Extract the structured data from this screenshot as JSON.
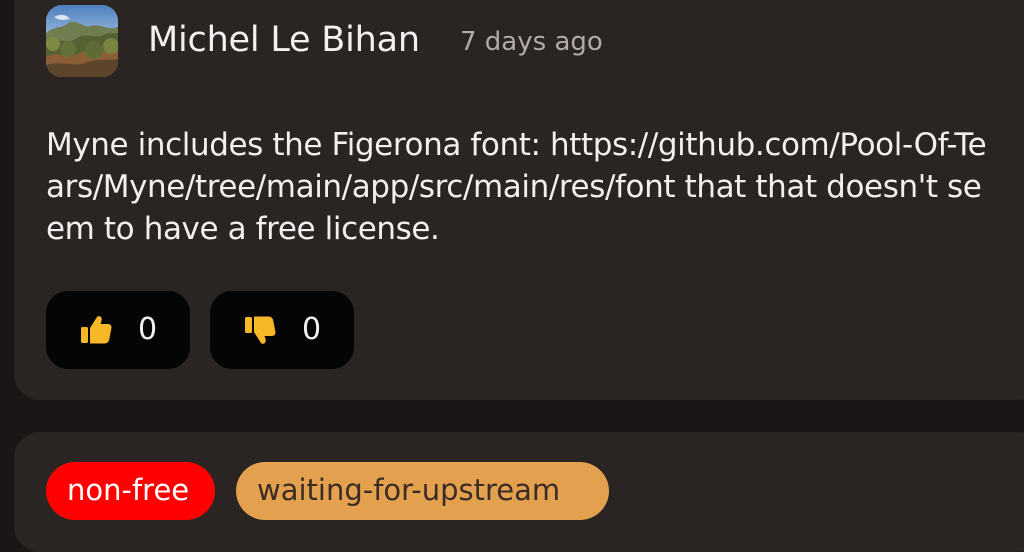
{
  "comment": {
    "author": "Michel Le Bihan",
    "timestamp": "7 days ago",
    "avatar_icon": "landscape-avatar-icon",
    "body": "Myne includes the Figerona font: https://github.com/Pool-Of-Tears/Myne/tree/main/app/src/main/res/font that that doesn't seem to have a free license.",
    "reactions": {
      "like": {
        "icon": "thumbs-up-icon",
        "count": "0"
      },
      "dislike": {
        "icon": "thumbs-down-icon",
        "count": "0"
      }
    }
  },
  "labels": [
    {
      "text": "non-free",
      "color": "#ff0000"
    },
    {
      "text": "waiting-for-upstream",
      "color": "#e3a04e"
    }
  ],
  "theme": {
    "background": "#1a1615",
    "card": "#2a2423",
    "accent": "#f6b826"
  }
}
